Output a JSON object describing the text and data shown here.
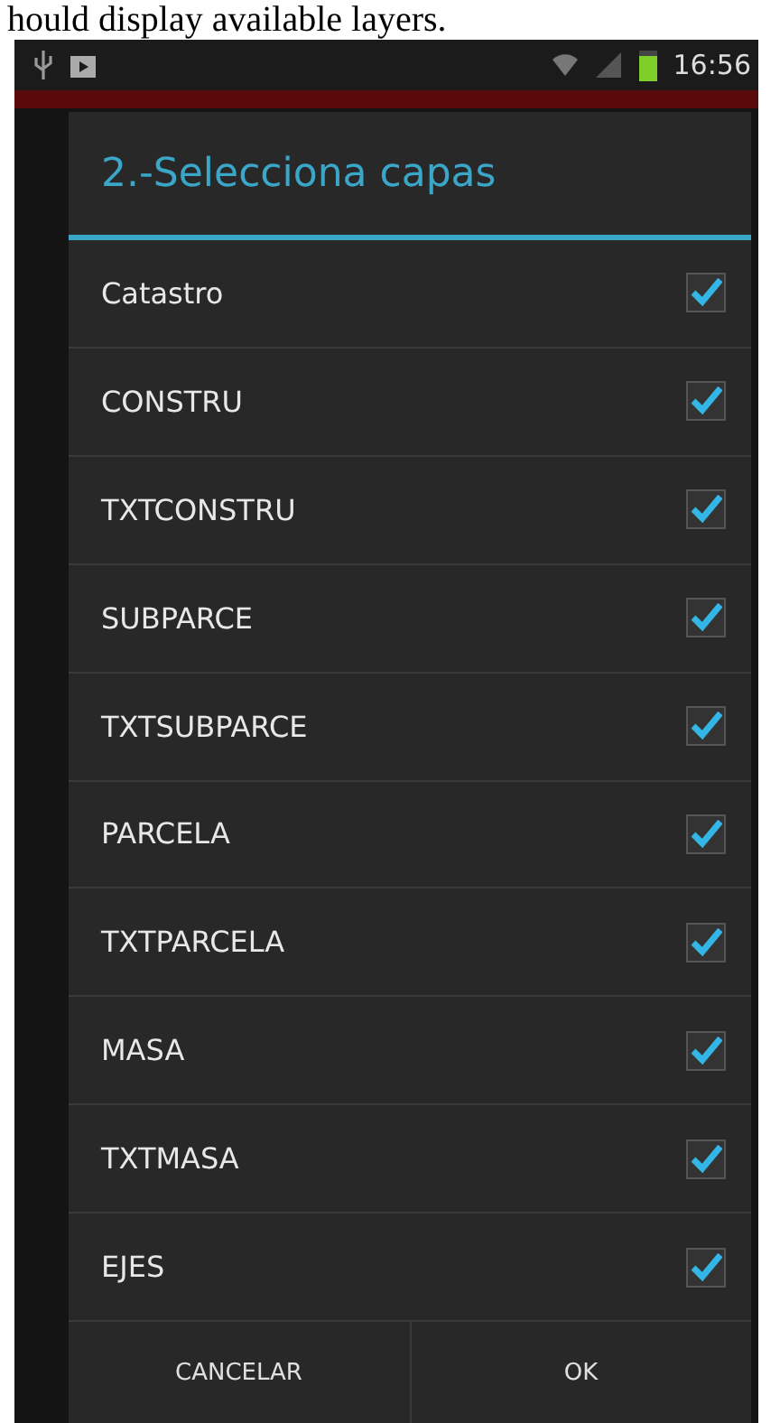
{
  "caption": "hould display available layers.",
  "status_bar": {
    "time": "16:56"
  },
  "dialog": {
    "title": "2.-Selecciona capas",
    "layers": [
      {
        "label": "Catastro",
        "checked": true
      },
      {
        "label": "CONSTRU",
        "checked": true
      },
      {
        "label": "TXTCONSTRU",
        "checked": true
      },
      {
        "label": "SUBPARCE",
        "checked": true
      },
      {
        "label": "TXTSUBPARCE",
        "checked": true
      },
      {
        "label": "PARCELA",
        "checked": true
      },
      {
        "label": "TXTPARCELA",
        "checked": true
      },
      {
        "label": "MASA",
        "checked": true
      },
      {
        "label": "TXTMASA",
        "checked": true
      },
      {
        "label": "EJES",
        "checked": true
      }
    ],
    "buttons": [
      {
        "label": "CANCELAR"
      },
      {
        "label": "OK"
      }
    ]
  }
}
